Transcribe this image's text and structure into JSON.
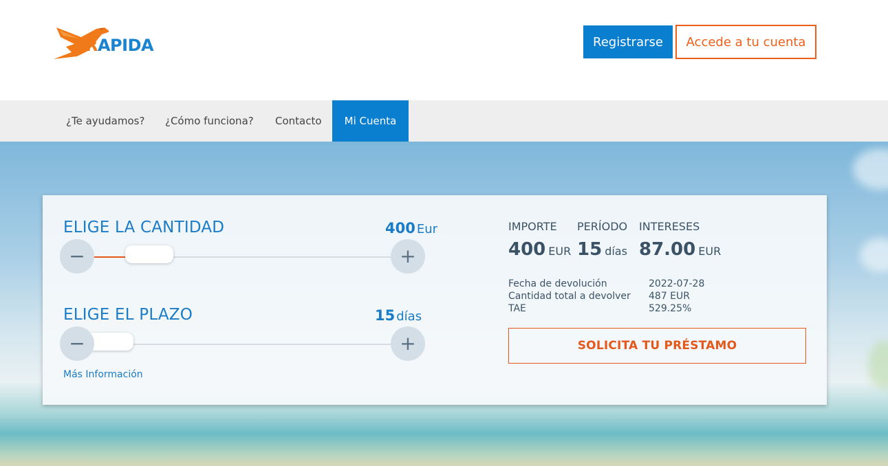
{
  "brand": {
    "logo_text_r": "R",
    "logo_text_rest": "APIDA",
    "colors": {
      "primary": "#0a7fd0",
      "accent": "#e4581c"
    }
  },
  "header": {
    "register_label": "Registrarse",
    "login_label": "Accede a tu cuenta"
  },
  "nav": {
    "items": [
      {
        "label": "¿Te ayudamos?"
      },
      {
        "label": "¿Cómo funciona?"
      },
      {
        "label": "Contacto"
      },
      {
        "label": "Mi Cuenta",
        "active": true
      }
    ]
  },
  "calculator": {
    "amount": {
      "title": "ELIGE LA CANTIDAD",
      "value": "400",
      "unit": "Eur",
      "minus": "−",
      "plus": "+",
      "level": 0.17
    },
    "term": {
      "title": "ELIGE EL PLAZO",
      "value": "15",
      "unit": "días",
      "minus": "−",
      "plus": "+",
      "level": 0.03
    },
    "more_info": "Más Información"
  },
  "summary": {
    "amount_label": "IMPORTE",
    "amount_value": "400",
    "amount_unit": "EUR",
    "period_label": "PERÍODO",
    "period_value": "15",
    "period_unit": "días",
    "interest_label": "INTERESES",
    "interest_value": "87.00",
    "interest_unit": "EUR",
    "due_date_label": "Fecha de devolución",
    "due_date_value": "2022-07-28",
    "total_label": "Cantidad total a devolver",
    "total_value": "487 EUR",
    "tae_label": "TAE",
    "tae_value": "529.25%",
    "apply_label": "SOLICITA TU PRÉSTAMO"
  }
}
